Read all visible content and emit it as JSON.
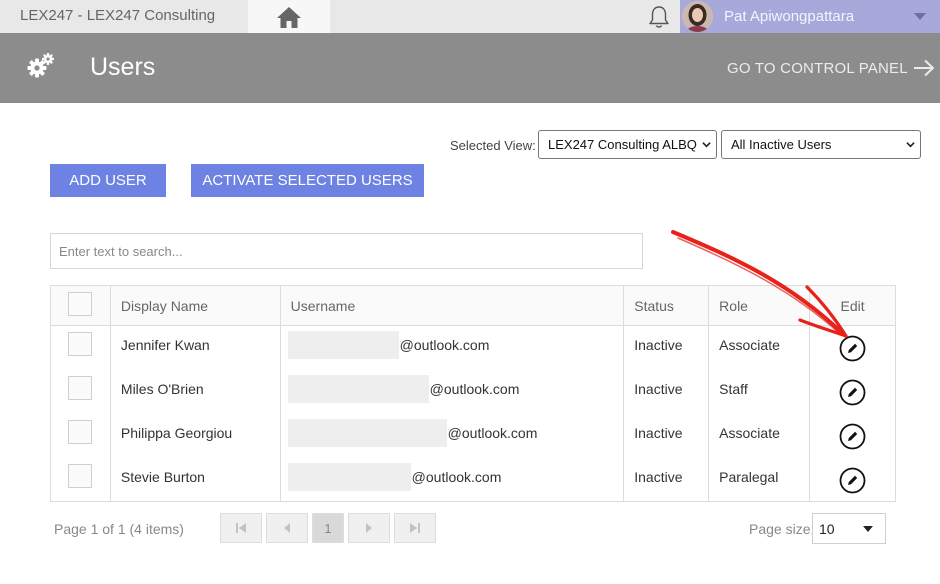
{
  "topbar": {
    "app_name": "LEX247   -  LEX247 Consulting",
    "user_name": "Pat Apiwongpattara"
  },
  "header": {
    "title": "Users",
    "control_panel_link": "GO TO CONTROL PANEL"
  },
  "view": {
    "label": "Selected View:",
    "site_value": "LEX247 Consulting ALBQ",
    "filter_value": "All Inactive Users"
  },
  "actions": {
    "add_user": "ADD USER",
    "activate_selected": "ACTIVATE SELECTED USERS"
  },
  "search": {
    "placeholder": "Enter text to search..."
  },
  "table": {
    "headers": {
      "display_name": "Display Name",
      "username": "Username",
      "status": "Status",
      "role": "Role",
      "edit": "Edit"
    },
    "rows": [
      {
        "display_name": "Jennifer Kwan",
        "username_domain": "@outlook.com",
        "status": "Inactive",
        "role": "Associate"
      },
      {
        "display_name": "Miles O'Brien",
        "username_domain": "@outlook.com",
        "status": "Inactive",
        "role": "Staff"
      },
      {
        "display_name": "Philippa Georgiou",
        "username_domain": "@outlook.com",
        "status": "Inactive",
        "role": "Associate"
      },
      {
        "display_name": "Stevie Burton",
        "username_domain": "@outlook.com",
        "status": "Inactive",
        "role": "Paralegal"
      }
    ]
  },
  "pager": {
    "info": "Page 1 of 1 (4 items)",
    "current_page": "1",
    "page_size_label": "Page size:",
    "page_size_value": "10"
  },
  "colors": {
    "accent_button": "#6d82e3",
    "header_bg": "#8c8c8c",
    "user_area_bg": "#a7a9da",
    "annotation_arrow": "#e8211b"
  },
  "icons": [
    "home-icon",
    "bell-icon",
    "gear-icon",
    "arrow-right-icon",
    "edit-pencil-icon",
    "first-page-icon",
    "prev-page-icon",
    "next-page-icon",
    "last-page-icon",
    "dropdown-caret-icon"
  ]
}
